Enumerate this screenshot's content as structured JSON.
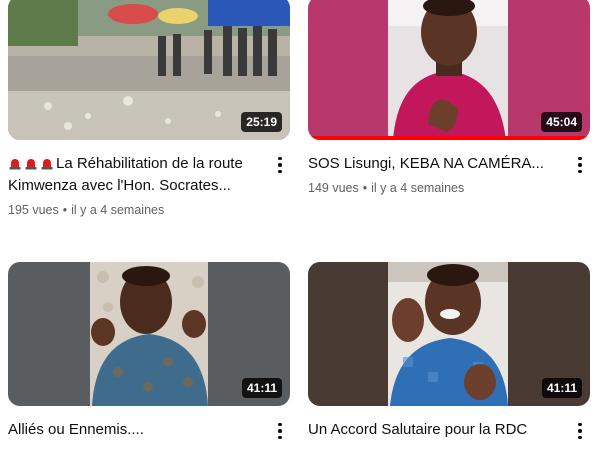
{
  "videos": [
    {
      "title": "La Réhabilitation de la route Kimwenza avec l'Hon. Socrates...",
      "title_prefix_icon": "police-light-icon",
      "views": "195 vues",
      "age": "il y a 4 semaines",
      "duration": "25:19"
    },
    {
      "title": "SOS Lisungi, KEBA NA CAMÉRA...",
      "views": "149 vues",
      "age": "il y a 4 semaines",
      "duration": "45:04",
      "watched_fraction": 1.0
    },
    {
      "title": "Alliés ou Ennemis....",
      "duration": "41:11"
    },
    {
      "title": "Un Accord Salutaire pour la RDC",
      "duration": "41:11"
    }
  ],
  "colors": {
    "progress": "#ff0000",
    "meta_text": "#606060",
    "title_text": "#0f0f0f"
  }
}
